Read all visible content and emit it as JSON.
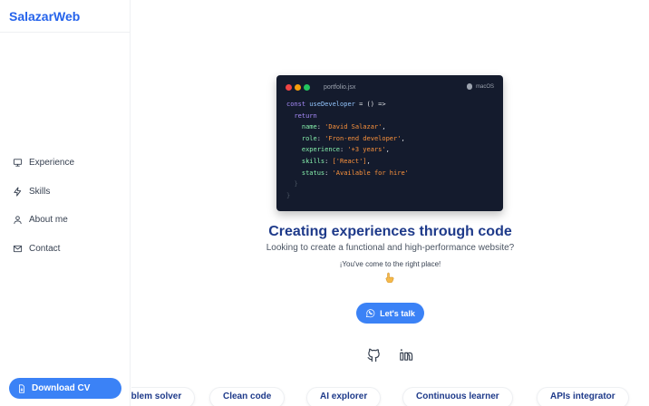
{
  "brand": "SalazarWeb",
  "nav": [
    {
      "label": "Experience",
      "icon": "monitor-icon"
    },
    {
      "label": "Skills",
      "icon": "lightning-icon"
    },
    {
      "label": "About me",
      "icon": "user-icon"
    },
    {
      "label": "Contact",
      "icon": "mail-icon"
    }
  ],
  "download_label": "Download CV",
  "code_card": {
    "filename": "portfolio.jsx",
    "os": "macOS",
    "dot_colors": [
      "#ef4444",
      "#f59e0b",
      "#22c55e"
    ],
    "line1_keyword": "const",
    "line1_fn": "useDeveloper",
    "line1_rest": " = () =>",
    "line2": "return",
    "lines": [
      {
        "key": "name",
        "value": "'David Salazar'",
        "suffix": ","
      },
      {
        "key": "role",
        "value": "'Fron-end developer'",
        "suffix": ","
      },
      {
        "key": "experience",
        "value": "'+3 years'",
        "suffix": ","
      },
      {
        "key": "skills",
        "value": "['React']",
        "suffix": ","
      },
      {
        "key": "status",
        "value": "'Available for hire'",
        "suffix": ""
      }
    ],
    "close1": "}",
    "close2": "}"
  },
  "hero": {
    "headline": "Creating experiences through code",
    "subtitle": "Looking to create a functional and high-performance website?",
    "subtitle2": "¡You've come to the right place!",
    "cta": "Let's talk"
  },
  "social": [
    "github-icon",
    "linkedin-icon"
  ],
  "skills_pills": [
    "Problem solver",
    "Clean code",
    "AI explorer",
    "Continuous learner",
    "APIs integrator"
  ],
  "colors": {
    "accent": "#3b82f6",
    "brand": "#2563eb",
    "headline": "#1e3a8a",
    "code_bg": "#141b2d"
  }
}
